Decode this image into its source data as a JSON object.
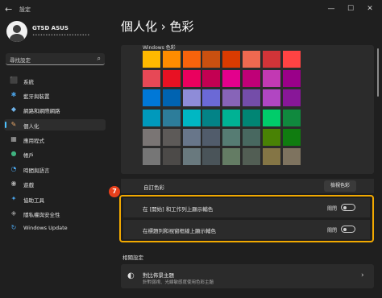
{
  "window": {
    "title": "設定",
    "back_icon": "←",
    "minimize": "—",
    "maximize": "☐",
    "close": "✕"
  },
  "user": {
    "name": "GTSD ASUS",
    "email": "••••••••••••••••••••••"
  },
  "search": {
    "placeholder": "尋找設定",
    "icon": "search-icon"
  },
  "sidebar": {
    "items": [
      {
        "label": "系統",
        "icon": "⬛",
        "icon_color": "#4aa3e8",
        "selected": false
      },
      {
        "label": "藍牙與裝置",
        "icon": "✱",
        "icon_color": "#4aa3e8",
        "selected": false
      },
      {
        "label": "網路和網際網路",
        "icon": "◆",
        "icon_color": "#6fb2e8",
        "selected": false
      },
      {
        "label": "個人化",
        "icon": "✎",
        "icon_color": "#e8a86a",
        "selected": true
      },
      {
        "label": "應用程式",
        "icon": "▦",
        "icon_color": "#b0b0b0",
        "selected": false
      },
      {
        "label": "帳戶",
        "icon": "●",
        "icon_color": "#3fb27f",
        "selected": false
      },
      {
        "label": "時間與語言",
        "icon": "◔",
        "icon_color": "#4aa3e8",
        "selected": false
      },
      {
        "label": "遊戲",
        "icon": "◉",
        "icon_color": "#b0b0b0",
        "selected": false
      },
      {
        "label": "協助工具",
        "icon": "✦",
        "icon_color": "#4aa3e8",
        "selected": false
      },
      {
        "label": "隱私權與安全性",
        "icon": "◈",
        "icon_color": "#9a9a9a",
        "selected": false
      },
      {
        "label": "Windows Update",
        "icon": "↻",
        "icon_color": "#4aa3e8",
        "selected": false
      }
    ]
  },
  "page": {
    "title": "個人化  ›  色彩"
  },
  "palette": {
    "label": "Windows 色彩",
    "colors": [
      [
        "#ffb900",
        "#ff8c00",
        "#f7630c",
        "#ca5010",
        "#da3b01",
        "#ef6950",
        "#d13438",
        "#ff4343"
      ],
      [
        "#e74856",
        "#e81123",
        "#ea005e",
        "#c30052",
        "#e3008c",
        "#bf0077",
        "#c239b3",
        "#9a0089"
      ],
      [
        "#0078d7",
        "#0063b1",
        "#8e8cd8",
        "#6b69d6",
        "#8764b8",
        "#744da9",
        "#b146c2",
        "#881798"
      ],
      [
        "#0099bc",
        "#2d7d9a",
        "#00b7c3",
        "#038387",
        "#00b294",
        "#018574",
        "#00cc6a",
        "#10893e"
      ],
      [
        "#7a7574",
        "#5d5a58",
        "#68768a",
        "#515c6b",
        "#567c73",
        "#486860",
        "#498205",
        "#107c10"
      ],
      [
        "#767676",
        "#4c4a48",
        "#69797e",
        "#4a5459",
        "#647c64",
        "#525e54",
        "#847545",
        "#7e735f"
      ]
    ]
  },
  "custom_color": {
    "label": "自訂色彩",
    "button": "檢視色彩"
  },
  "step_badge": "7",
  "toggles": [
    {
      "label": "在 [開始] 和工作列上顯示輔色",
      "state": "關閉",
      "on": false
    },
    {
      "label": "在標題列和視窗框線上顯示輔色",
      "state": "關閉",
      "on": false
    }
  ],
  "related": {
    "heading": "相關設定",
    "title": "對比佈景主題",
    "subtitle": "針對弱視、光線敏感度使用色彩主題",
    "icon": "◐",
    "chevron": "›"
  }
}
